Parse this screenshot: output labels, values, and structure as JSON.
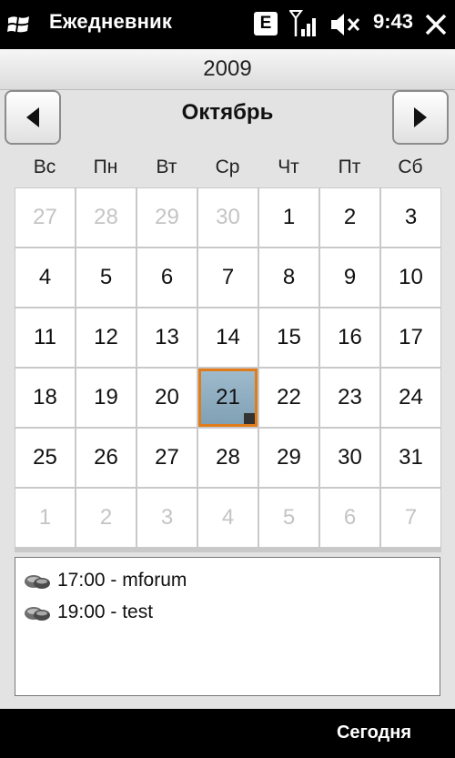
{
  "status_bar": {
    "app_title": "Ежедневник",
    "network_badge": "E",
    "time": "9:43",
    "icons": [
      "windows-start-icon",
      "signal-icon",
      "volume-muted-icon",
      "close-icon"
    ]
  },
  "calendar": {
    "year": "2009",
    "month": "Октябрь",
    "weekdays": [
      "Вс",
      "Пн",
      "Вт",
      "Ср",
      "Чт",
      "Пт",
      "Сб"
    ],
    "weeks": [
      [
        "27",
        "28",
        "29",
        "30",
        "1",
        "2",
        "3"
      ],
      [
        "4",
        "5",
        "6",
        "7",
        "8",
        "9",
        "10"
      ],
      [
        "11",
        "12",
        "13",
        "14",
        "15",
        "16",
        "17"
      ],
      [
        "18",
        "19",
        "20",
        "21",
        "22",
        "23",
        "24"
      ],
      [
        "25",
        "26",
        "27",
        "28",
        "29",
        "30",
        "31"
      ],
      [
        "1",
        "2",
        "3",
        "4",
        "5",
        "6",
        "7"
      ]
    ],
    "selected_date": "21",
    "colors": {
      "selection_border": "#e07c1b",
      "selection_fill": "#8fb0c2",
      "dim_text": "#c4c4c4"
    }
  },
  "appointments": [
    {
      "text": "17:00 - mforum",
      "icon": "appointment-icon"
    },
    {
      "text": "19:00 - test",
      "icon": "appointment-icon"
    }
  ],
  "softkeys": {
    "right": "Сегодня"
  }
}
